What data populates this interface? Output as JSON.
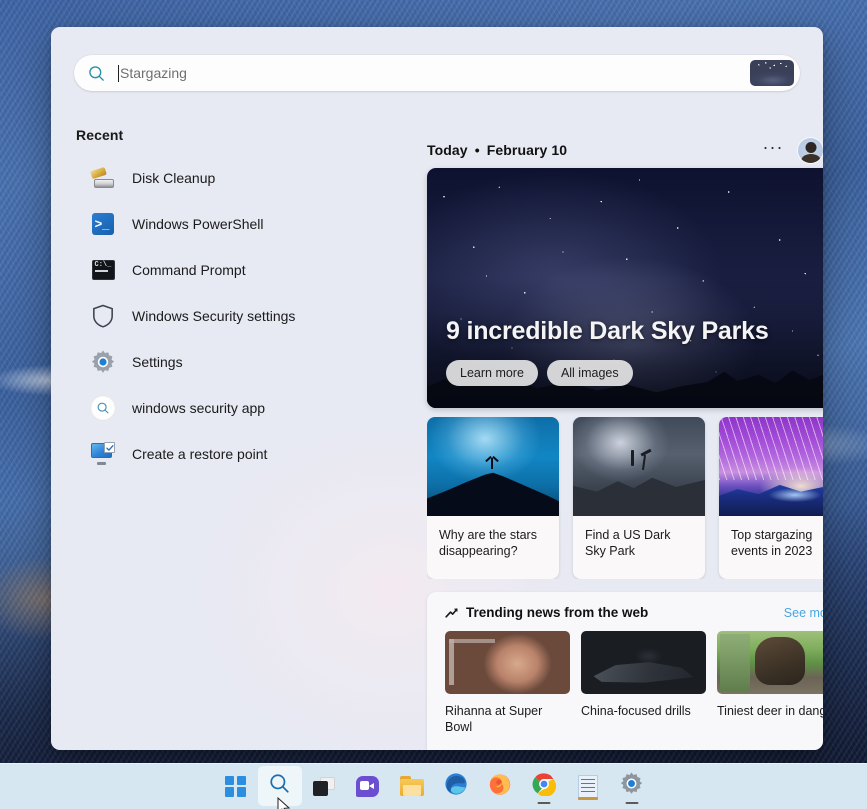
{
  "window": {
    "app": "Windows Search",
    "panel_bg": "#e7e9f3"
  },
  "search": {
    "placeholder": "Stargazing",
    "value": "",
    "icon": "search-icon",
    "thumbnail_alt": "stargazing-thumbnail"
  },
  "sidebar": {
    "title": "Recent",
    "items": [
      {
        "label": "Disk Cleanup",
        "icon": "disk-cleanup-icon"
      },
      {
        "label": "Windows PowerShell",
        "icon": "powershell-icon"
      },
      {
        "label": "Command Prompt",
        "icon": "command-prompt-icon"
      },
      {
        "label": "Windows Security settings",
        "icon": "shield-icon"
      },
      {
        "label": "Settings",
        "icon": "gear-icon"
      },
      {
        "label": "windows security app",
        "icon": "search-icon"
      },
      {
        "label": "Create a restore point",
        "icon": "restore-point-icon"
      }
    ]
  },
  "feed": {
    "header": {
      "today": "Today",
      "separator": "•",
      "date": "February 10",
      "more_label": "···",
      "avatar_alt": "user-avatar"
    },
    "hero": {
      "title": "9 incredible Dark Sky Parks",
      "buttons": [
        {
          "label": "Learn more"
        },
        {
          "label": "All images"
        }
      ],
      "image_alt": "milky-way-night-sky"
    },
    "cards": [
      {
        "caption": "Why are the stars disappearing?",
        "image_alt": "person-on-hill-under-blue-milky-way"
      },
      {
        "caption": "Find a US Dark Sky Park",
        "image_alt": "astronomer-with-telescope-on-rocks"
      },
      {
        "caption": "Top stargazing events in 2023",
        "image_alt": "purple-meteor-shower-over-mountains"
      }
    ],
    "cards_scroll_next": "chevron-right-icon"
  },
  "trending": {
    "title": "Trending news from the web",
    "trend_icon": "trending-up-arrow-icon",
    "see_more": "See more",
    "items": [
      {
        "caption": "Rihanna at Super Bowl",
        "image_alt": "rihanna-waving-on-red-carpet"
      },
      {
        "caption": "China-focused drills",
        "image_alt": "military-fighter-jet-cockpit"
      },
      {
        "caption": "Tiniest deer in danger",
        "image_alt": "person-carrying-small-deer"
      }
    ],
    "scroll_next": "chevron-right-icon"
  },
  "taskbar": {
    "items": [
      {
        "name": "start",
        "label": "Start",
        "icon": "windows-logo-icon",
        "active": false,
        "running": false
      },
      {
        "name": "search",
        "label": "Search",
        "icon": "search-icon",
        "active": true,
        "running": false
      },
      {
        "name": "task-view",
        "label": "Task View",
        "icon": "task-view-icon",
        "active": false,
        "running": false
      },
      {
        "name": "chat",
        "label": "Chat",
        "icon": "teams-chat-icon",
        "active": false,
        "running": false
      },
      {
        "name": "file-explorer",
        "label": "File Explorer",
        "icon": "folder-icon",
        "active": false,
        "running": false
      },
      {
        "name": "edge",
        "label": "Microsoft Edge",
        "icon": "edge-icon",
        "active": false,
        "running": false
      },
      {
        "name": "firefox",
        "label": "Firefox",
        "icon": "firefox-icon",
        "active": false,
        "running": false
      },
      {
        "name": "chrome",
        "label": "Google Chrome",
        "icon": "chrome-icon",
        "active": false,
        "running": true
      },
      {
        "name": "notepad",
        "label": "Notepad",
        "icon": "notepad-icon",
        "active": false,
        "running": false
      },
      {
        "name": "settings",
        "label": "Settings",
        "icon": "gear-icon",
        "active": false,
        "running": true
      }
    ]
  },
  "colors": {
    "accent": "#2a8fe0",
    "link": "#4aa6e0",
    "panel": "#e7e9f3",
    "taskbar": "#d6e7f1",
    "card": "#fbf8f9",
    "trending_panel": "#f8f7f9"
  }
}
